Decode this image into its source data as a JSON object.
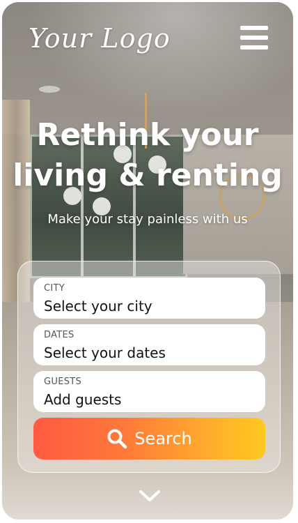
{
  "header": {
    "logo_text": "Your Logo",
    "menu_icon": "hamburger-icon"
  },
  "hero": {
    "title_line1": "Rethink your",
    "title_line2": "living & renting",
    "subtitle": "Make your stay painless with us"
  },
  "search_form": {
    "city": {
      "label": "CITY",
      "value": "Select your city"
    },
    "dates": {
      "label": "DATES",
      "value": "Select your dates"
    },
    "guests": {
      "label": "GUESTS",
      "value": "Add guests"
    },
    "search_button": {
      "label": "Search",
      "icon": "search-icon"
    }
  },
  "scroll_indicator": {
    "icon": "chevron-down-icon"
  },
  "colors": {
    "button_gradient_start": "#ff5a42",
    "button_gradient_end": "#ffc81f",
    "text_on_hero": "#ffffff"
  }
}
